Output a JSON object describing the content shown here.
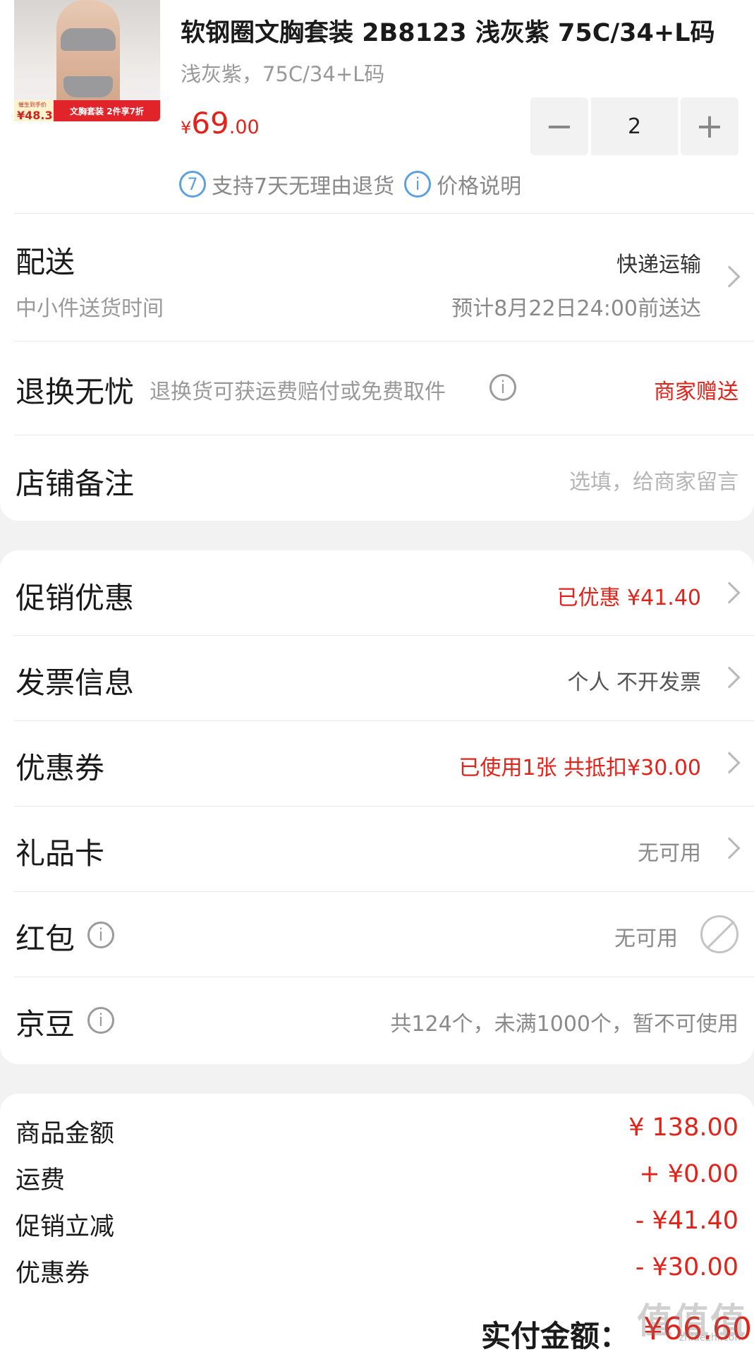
{
  "product": {
    "promo_small": "催生到手价",
    "promo_price": "¥48.3",
    "promo_label": "文胸套装 2件享7折",
    "title": "软钢圈文胸套装 2B8123 浅灰紫 75C/34+L码",
    "spec": "浅灰紫，75C/34+L码",
    "price_currency": "¥",
    "price_integer": "69",
    "price_decimal": ".00",
    "quantity": "2",
    "minus_symbol": "−",
    "plus_symbol": "+",
    "service_7day_icon": "7",
    "service_7day": "支持7天无理由退货",
    "price_info_icon": "i",
    "price_info": "价格说明"
  },
  "delivery": {
    "label": "配送",
    "sub_label": "中小件送货时间",
    "method": "快递运输",
    "eta": "预计8月22日24:00前送达"
  },
  "return_worry_free": {
    "label": "退换无忧",
    "description": "退换货可获运费赔付或免费取件",
    "info_icon": "i",
    "value": "商家赠送"
  },
  "store_note": {
    "label": "店铺备注",
    "placeholder": "选填，给商家留言"
  },
  "options": {
    "promotion": {
      "label": "促销优惠",
      "value": "已优惠 ¥41.40"
    },
    "invoice": {
      "label": "发票信息",
      "value": "个人 不开发票"
    },
    "coupon": {
      "label": "优惠券",
      "value": "已使用1张 共抵扣¥30.00"
    },
    "gift_card": {
      "label": "礼品卡",
      "value": "无可用"
    },
    "red_packet": {
      "label": "红包",
      "info_icon": "i",
      "value": "无可用"
    },
    "jingdou": {
      "label": "京豆",
      "info_icon": "i",
      "value": "共124个，未满1000个，暂不可使用"
    }
  },
  "summary": {
    "goods_amount": {
      "label": "商品金额",
      "value": "¥ 138.00"
    },
    "shipping": {
      "label": "运费",
      "value": "+ ¥0.00"
    },
    "promo_reduction": {
      "label": "促销立减",
      "value": "- ¥41.40"
    },
    "coupon": {
      "label": "优惠券",
      "value": "- ¥30.00"
    },
    "total_label": "实付金额：",
    "total_value": "¥66.60"
  },
  "watermark": {
    "text": "值值值",
    "sub": "zhidezhi.com"
  },
  "colors": {
    "accent_red": "#e2231a",
    "info_blue": "#5c9fe3",
    "background": "#f2f2f2"
  }
}
